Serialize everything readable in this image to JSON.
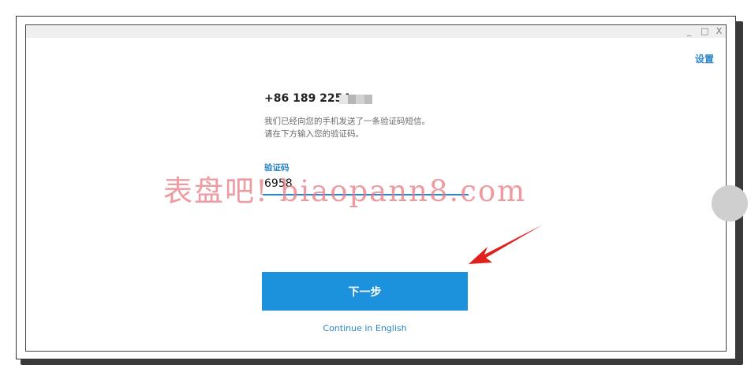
{
  "window": {
    "controls": {
      "minimize": "_",
      "maximize": "□",
      "close": "X"
    }
  },
  "header": {
    "settings_label": "设置"
  },
  "login": {
    "phone_number": "+86 189 2254",
    "phone_mask_colors": [
      "#e6e6e6",
      "#b5b5b5",
      "#d2d2d2",
      "#bdbdbd"
    ],
    "hint_line1": "我们已经向您的手机发送了一条验证码短信。",
    "hint_line2": "请在下方输入您的验证码。",
    "code_label": "验证码",
    "code_value": "6958",
    "next_button_label": "下一步",
    "language_link": "Continue in English"
  },
  "overlay": {
    "watermark_text": "表盘吧! biaopann8.com",
    "arrow_color": "#e0201c"
  },
  "colors": {
    "accent": "#2a86c6",
    "button": "#1c91dc"
  }
}
